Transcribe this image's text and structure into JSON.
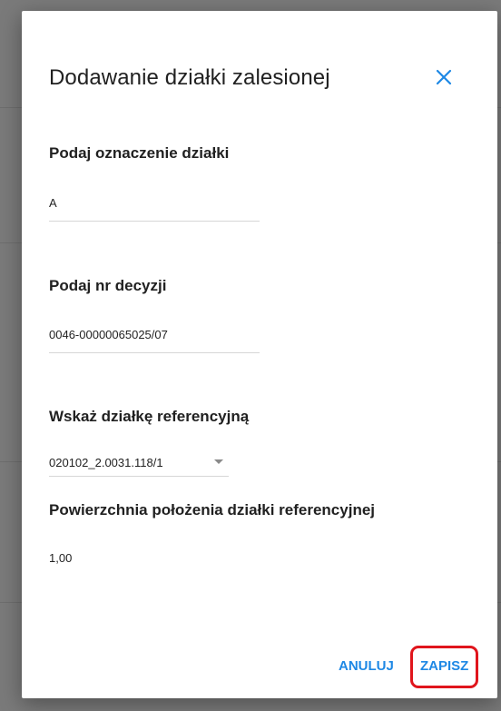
{
  "dialog": {
    "title": "Dodawanie działki zalesionej",
    "close_icon": "close-icon",
    "accent_color": "#1e88e5"
  },
  "plot_designation": {
    "label": "Podaj oznaczenie działki",
    "value": "A"
  },
  "decision_number": {
    "label": "Podaj nr decyzji",
    "value": "0046-00000065025/07"
  },
  "reference_plot": {
    "label": "Wskaż działkę referencyjną",
    "selected": "020102_2.0031.118/1",
    "caret_icon": "caret-down-icon"
  },
  "reference_area": {
    "label": "Powierzchnia położenia działki referencyjnej",
    "value": "1,00"
  },
  "actions": {
    "cancel_label": "ANULUJ",
    "save_label": "ZAPISZ",
    "highlight_color": "#e0151c"
  }
}
